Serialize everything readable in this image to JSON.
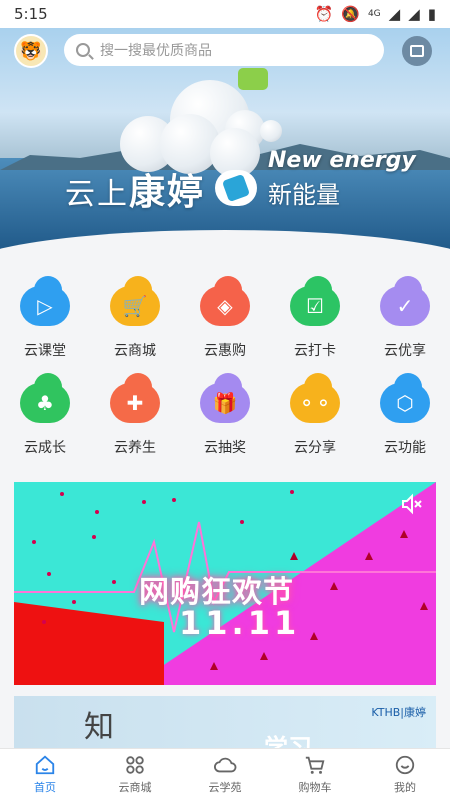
{
  "status_bar": {
    "time": "5:15",
    "network": "4G"
  },
  "header": {
    "search_placeholder": "搜一搜最优质商品"
  },
  "hero": {
    "title_prefix": "云上",
    "title_main": "康婷",
    "tagline_en": "New energy",
    "tagline_cn": "新能量"
  },
  "grid": {
    "rows": [
      [
        {
          "label": "云课堂",
          "icon": "play-icon",
          "color": "#2f9ff0"
        },
        {
          "label": "云商城",
          "icon": "cart-icon",
          "color": "#f7b21c"
        },
        {
          "label": "云惠购",
          "icon": "tag-icon",
          "color": "#f5624a"
        },
        {
          "label": "云打卡",
          "icon": "calendar-check-icon",
          "color": "#2cc464"
        },
        {
          "label": "云优享",
          "icon": "shield-check-icon",
          "color": "#a58cf0"
        }
      ],
      [
        {
          "label": "云成长",
          "icon": "tree-icon",
          "color": "#30c45f"
        },
        {
          "label": "云养生",
          "icon": "health-bag-icon",
          "color": "#f56a48"
        },
        {
          "label": "云抽奖",
          "icon": "gift-icon",
          "color": "#a48af0"
        },
        {
          "label": "云分享",
          "icon": "share-icon",
          "color": "#f7b21c"
        },
        {
          "label": "云功能",
          "icon": "cube-icon",
          "color": "#2f9ff0"
        }
      ]
    ]
  },
  "promo": {
    "title": "网购狂欢节",
    "date": "11.11"
  },
  "promo2": {
    "big_char": "知",
    "brand": "KTHB|康婷",
    "word": "学习"
  },
  "tabbar": [
    {
      "label": "首页",
      "icon": "home-icon",
      "active": true
    },
    {
      "label": "云商城",
      "icon": "grid-icon",
      "active": false
    },
    {
      "label": "云学苑",
      "icon": "cloud-icon",
      "active": false
    },
    {
      "label": "购物车",
      "icon": "cart-icon",
      "active": false
    },
    {
      "label": "我的",
      "icon": "smile-icon",
      "active": false
    }
  ]
}
